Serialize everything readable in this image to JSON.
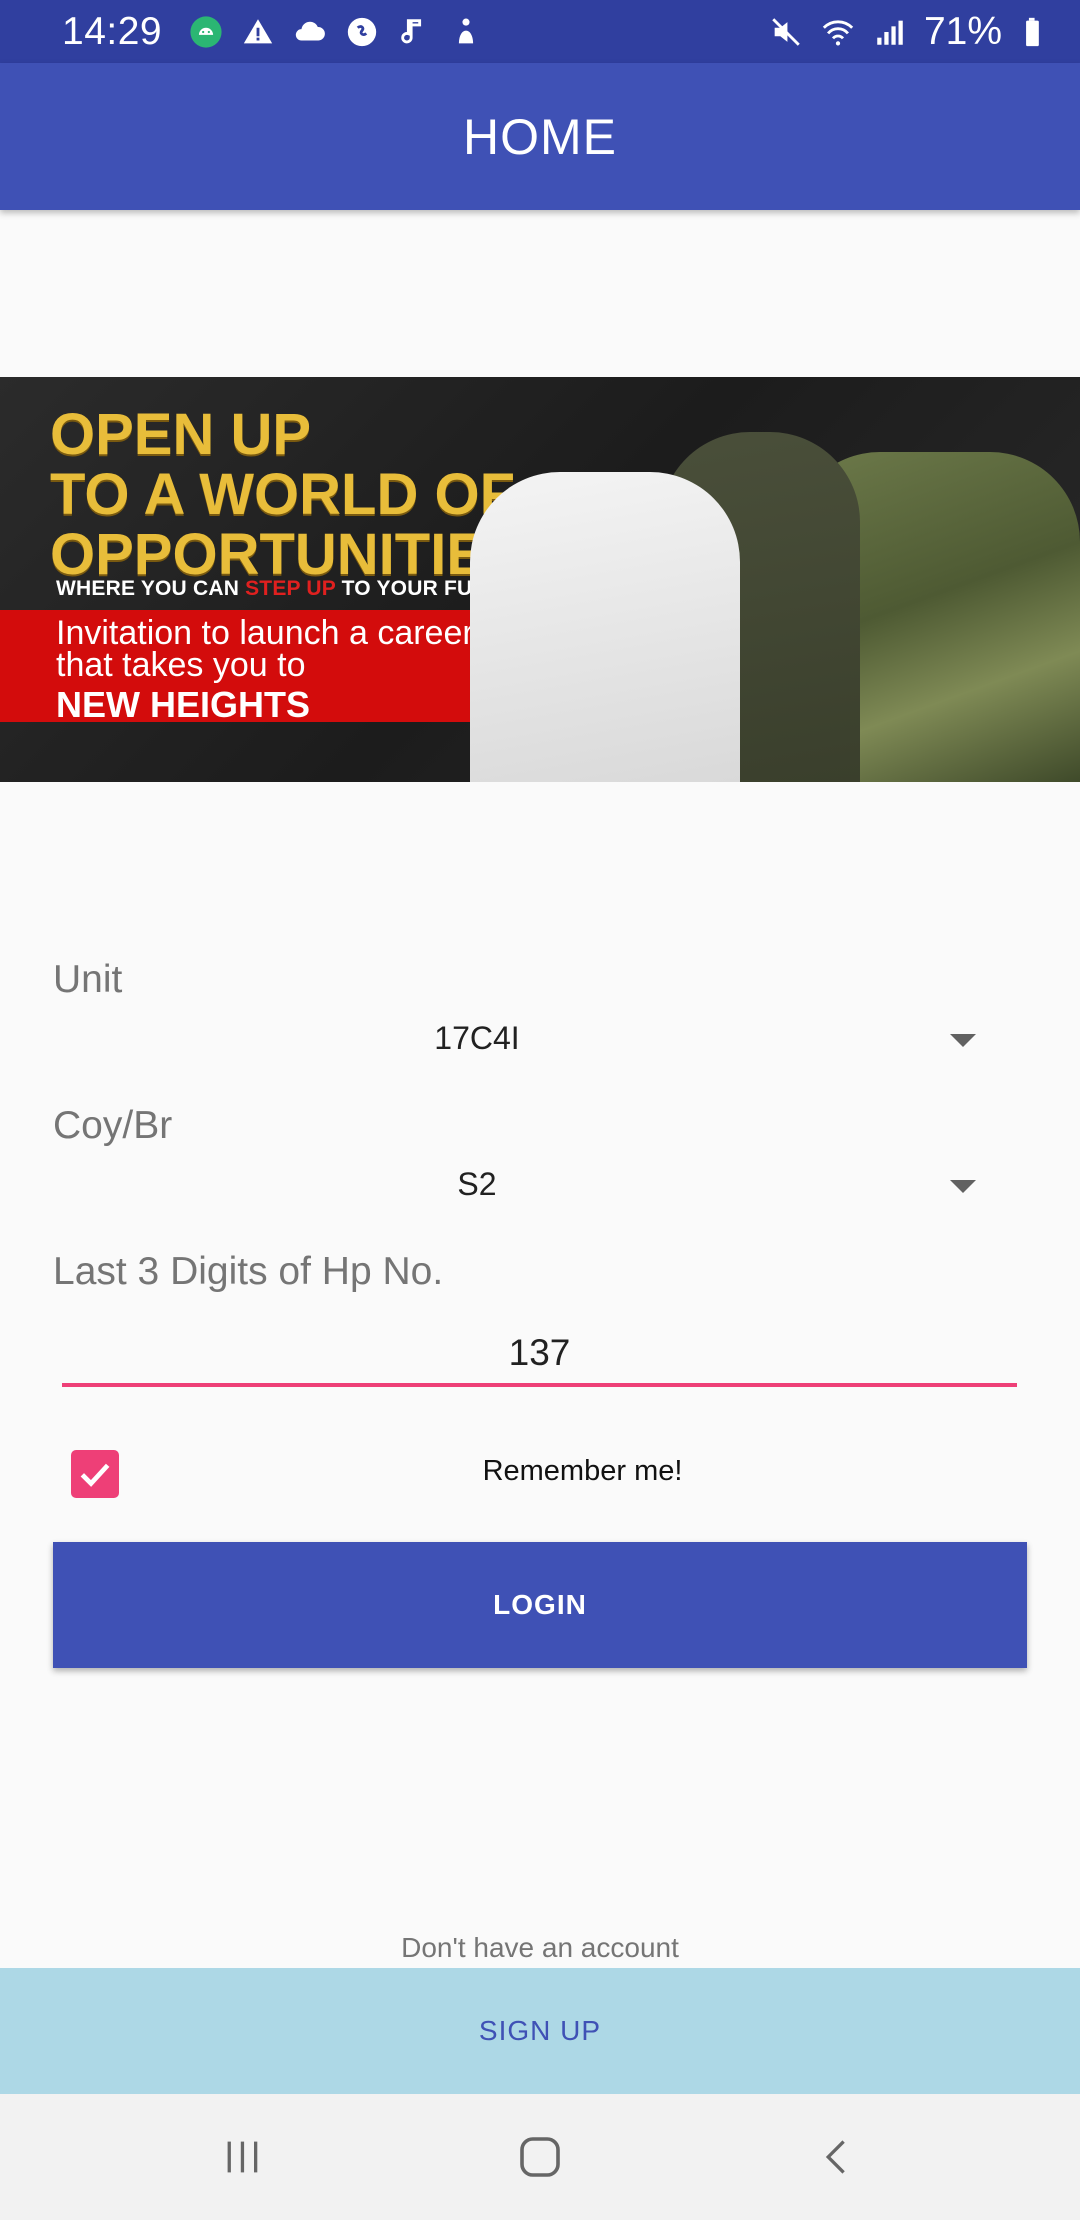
{
  "status_bar": {
    "time": "14:29",
    "battery": "71%",
    "left_icons": [
      "android-icon",
      "warning-icon",
      "cloud-sync-icon",
      "shazam-icon",
      "music-note-icon",
      "accessibility-icon"
    ],
    "right_icons": [
      "mute-icon",
      "wifi-icon",
      "signal-icon",
      "battery-icon"
    ]
  },
  "app_bar": {
    "title": "HOME"
  },
  "banner": {
    "headline": "OPEN UP\nTO A WORLD OF\nOPPORTUNITIES",
    "sub_prefix": "WHERE YOU CAN ",
    "sub_highlight": "STEP UP",
    "sub_suffix": " TO YOUR FULL POTENTIAL",
    "invitation": "Invitation to launch a career\nthat takes you to",
    "new_heights": "NEW HEIGHTS"
  },
  "form": {
    "unit_label": "Unit",
    "unit_value": "17C4I",
    "coy_label": "Coy/Br",
    "coy_value": "S2",
    "hp_label": "Last 3 Digits of Hp No.",
    "hp_value": "137",
    "remember_label": "Remember me!",
    "remember_checked": true,
    "login_label": "LOGIN"
  },
  "footer": {
    "no_account_text": "Don't have an account",
    "signup_label": "SIGN UP"
  },
  "colors": {
    "primary": "#3f51b5",
    "primary_dark": "#303f9f",
    "accent": "#ee3f77",
    "signup_bg": "#add8e6"
  }
}
